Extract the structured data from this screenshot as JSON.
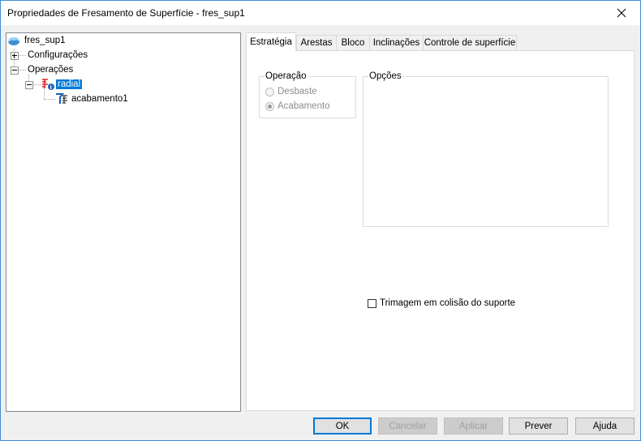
{
  "window": {
    "title": "Propriedades de Fresamento de Superfície - fres_sup1",
    "close_icon": "close-icon"
  },
  "tree": {
    "root": {
      "label": "fres_sup1",
      "icon": "surface-icon"
    },
    "configuracoes": {
      "label": "Configurações",
      "expanded": false
    },
    "operacoes": {
      "label": "Operações",
      "expanded": true
    },
    "radial": {
      "label": "radial",
      "icon": "radial-operation-icon",
      "selected": true,
      "expanded": true
    },
    "acabamento": {
      "label": "acabamento1",
      "icon": "finish-operation-icon"
    }
  },
  "tabs": [
    {
      "label": "Estratégia",
      "active": true
    },
    {
      "label": "Arestas"
    },
    {
      "label": "Bloco"
    },
    {
      "label": "Inclinações"
    },
    {
      "label": "Controle de superfície"
    }
  ],
  "operacao_group": {
    "legend": "Operação",
    "options": [
      {
        "label": "Desbaste",
        "checked": false,
        "enabled": false
      },
      {
        "label": "Acabamento",
        "checked": true,
        "enabled": false
      }
    ]
  },
  "opcoes_group": {
    "legend": "Opções"
  },
  "trim_checkbox": {
    "label": "Trimagem em colisão do suporte",
    "checked": false
  },
  "buttons": {
    "ok": "OK",
    "cancel": "Cancelar",
    "apply": "Aplicar",
    "preview": "Prever",
    "help": "Ajuda"
  },
  "colors": {
    "selection": "#0078d7",
    "window_border": "#3c8fd6",
    "radial_icon": "#d8262f"
  }
}
